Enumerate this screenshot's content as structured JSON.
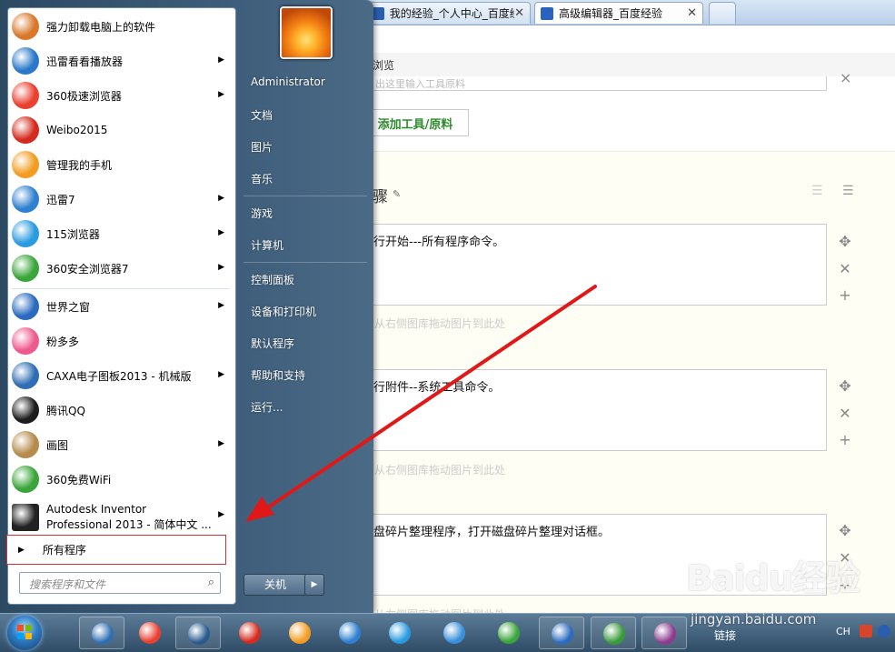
{
  "browser": {
    "tabs": [
      {
        "label": "我的经验_个人中心_百度经"
      },
      {
        "label": "高级编辑器_百度经验"
      }
    ],
    "bookmark_label": "浏览",
    "tool_input_placeholder": "出这里输入工具原料",
    "add_tool_button": "添加工具/原料",
    "steps_heading": "骤",
    "steps": [
      {
        "text": "行开始---所有程序命令。"
      },
      {
        "text": "行附件--系统工具命令。"
      },
      {
        "text": "盘碎片整理程序，打开磁盘碎片整理对话框。"
      }
    ],
    "drop_hint": "从右侧图库拖动图片到此处",
    "watermark": "Baidu经验",
    "watermark_url": "jingyan.baidu.com"
  },
  "start_menu": {
    "programs": [
      {
        "label": "强力卸载电脑上的软件",
        "icon": "uninstall-icon",
        "arrow": false,
        "color": "#d9772b"
      },
      {
        "label": "迅雷看看播放器",
        "icon": "xunlei-player-icon",
        "arrow": true,
        "color": "#2a78c9"
      },
      {
        "label": "360极速浏览器",
        "icon": "360-chrome-icon",
        "arrow": true,
        "color": "#e9402f"
      },
      {
        "label": "Weibo2015",
        "icon": "weibo-icon",
        "arrow": false,
        "color": "#d52b1e"
      },
      {
        "label": "管理我的手机",
        "icon": "phone-manager-icon",
        "arrow": false,
        "color": "#f39c21"
      },
      {
        "label": "迅雷7",
        "icon": "xunlei-icon",
        "arrow": true,
        "color": "#2f80d1"
      },
      {
        "label": "115浏览器",
        "icon": "115-browser-icon",
        "arrow": true,
        "color": "#2a9be0"
      },
      {
        "label": "360安全浏览器7",
        "icon": "360-safe-browser-icon",
        "arrow": true,
        "color": "#3aa53a"
      },
      {
        "label": "世界之窗",
        "icon": "theworld-icon",
        "arrow": true,
        "color": "#2b6bbf"
      },
      {
        "label": "粉多多",
        "icon": "fenduoduo-icon",
        "arrow": false,
        "color": "#ee5a8e"
      },
      {
        "label": "CAXA电子图板2013 - 机械版",
        "icon": "caxa-icon",
        "arrow": true,
        "color": "#2f6db5"
      },
      {
        "label": "腾讯QQ",
        "icon": "qq-icon",
        "arrow": false,
        "color": "#1d1d1d"
      },
      {
        "label": "画图",
        "icon": "paint-icon",
        "arrow": true,
        "color": "#b68a4a"
      },
      {
        "label": "360免费WiFi",
        "icon": "wifi-icon",
        "arrow": false,
        "color": "#3aa53a"
      },
      {
        "label": "Autodesk Inventor",
        "label2": "Professional 2013 - 简体中文 ...",
        "icon": "inventor-icon",
        "arrow": true,
        "color": "#222222"
      }
    ],
    "all_programs": "所有程序",
    "search_placeholder": "搜索程序和文件",
    "user_name": "Administrator",
    "right_links": [
      "文档",
      "图片",
      "音乐",
      "游戏",
      "计算机",
      "控制面板",
      "设备和打印机",
      "默认程序",
      "帮助和支持",
      "运行..."
    ],
    "shutdown": "关机"
  },
  "taskbar": {
    "apps": [
      {
        "icon": "media-center-icon",
        "color": "#2f6fb1",
        "boxed": true
      },
      {
        "icon": "360-chrome-icon",
        "color": "#e9402f",
        "boxed": false
      },
      {
        "icon": "video-player-icon",
        "color": "#2a5b8f",
        "boxed": true
      },
      {
        "icon": "weibo-icon",
        "color": "#d52b1e",
        "boxed": false
      },
      {
        "icon": "phone-manager-icon",
        "color": "#f39c21",
        "boxed": false
      },
      {
        "icon": "xunlei-icon",
        "color": "#2f80d1",
        "boxed": false
      },
      {
        "icon": "115-browser-icon",
        "color": "#2a9be0",
        "boxed": false
      },
      {
        "icon": "cloud-disk-icon",
        "color": "#3a8fd9",
        "boxed": false
      },
      {
        "icon": "360-safe-browser-icon",
        "color": "#3aa53a",
        "boxed": false
      },
      {
        "icon": "theworld-icon",
        "color": "#2b6bbf",
        "boxed": true
      },
      {
        "icon": "360-guard-icon",
        "color": "#3a9b3a",
        "boxed": true
      },
      {
        "icon": "winrar-icon",
        "color": "#8c3b8f",
        "boxed": true
      }
    ],
    "tray_link": "链接",
    "input_indicator": "CH"
  }
}
